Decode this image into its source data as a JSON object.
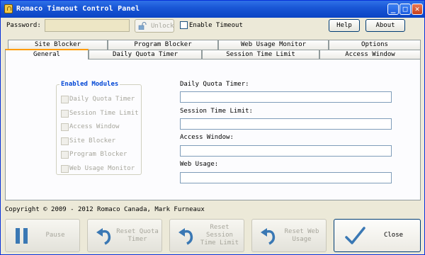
{
  "window": {
    "title": "Romaco Timeout Control Panel",
    "minimize": "_",
    "maximize": "□",
    "close": "✕"
  },
  "toolbar": {
    "password_label": "Password:",
    "password_value": "",
    "unlock_label": "Unlock",
    "enable_timeout_label": "Enable Timeout",
    "enable_timeout_checked": false,
    "help_label": "Help",
    "about_label": "About"
  },
  "tabs": {
    "row_back": [
      "Site Blocker",
      "Program Blocker",
      "Web Usage Monitor",
      "Options"
    ],
    "row_front": [
      "General",
      "Daily Quota Timer",
      "Session Time Limit",
      "Access Window"
    ],
    "active": "General"
  },
  "general": {
    "modules_title": "Enabled Modules",
    "modules": [
      {
        "label": "Daily Quota Timer",
        "checked": false,
        "enabled": false
      },
      {
        "label": "Session Time Limit",
        "checked": false,
        "enabled": false
      },
      {
        "label": "Access Window",
        "checked": false,
        "enabled": false
      },
      {
        "label": "Site Blocker",
        "checked": false,
        "enabled": false
      },
      {
        "label": "Program Blocker",
        "checked": false,
        "enabled": false
      },
      {
        "label": "Web Usage Monitor",
        "checked": false,
        "enabled": false
      }
    ],
    "fields": [
      {
        "label": "Daily Quota Timer:",
        "value": ""
      },
      {
        "label": "Session Time Limit:",
        "value": ""
      },
      {
        "label": "Access Window:",
        "value": ""
      },
      {
        "label": "Web Usage:",
        "value": ""
      }
    ]
  },
  "footer": {
    "copyright": "Copyright © 2009 - 2012 Romaco Canada, Mark Furneaux"
  },
  "actions": {
    "pause": "Pause",
    "reset_quota": "Reset Quota Timer",
    "reset_session": "Reset Session Time Limit",
    "reset_web": "Reset Web Usage",
    "close": "Close"
  },
  "colors": {
    "accent": "#1a57d6",
    "group_title": "#0046d5",
    "disabled_text": "#a7a69c",
    "icon_blue": "#3a78b4"
  }
}
